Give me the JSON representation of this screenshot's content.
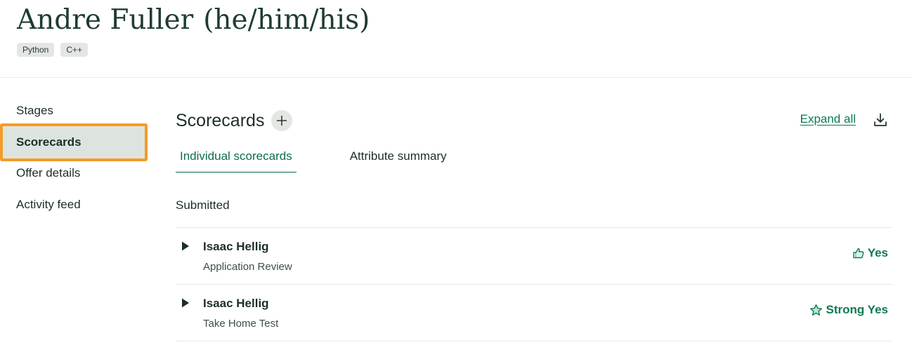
{
  "candidate": {
    "name": "Andre Fuller",
    "pronouns": "(he/him/his)",
    "tags": [
      "Python",
      "C++"
    ]
  },
  "sidebar": {
    "items": [
      {
        "label": "Stages"
      },
      {
        "label": "Scorecards",
        "active": true
      },
      {
        "label": "Offer details"
      },
      {
        "label": "Activity feed"
      }
    ]
  },
  "scorecards": {
    "title": "Scorecards",
    "add_icon": "plus-icon",
    "expand_all_label": "Expand all",
    "download_icon": "download-icon",
    "tabs": [
      {
        "label": "Individual scorecards",
        "active": true
      },
      {
        "label": "Attribute summary"
      }
    ],
    "section_label": "Submitted",
    "rows": [
      {
        "name": "Isaac Hellig",
        "stage": "Application Review",
        "rating": "Yes",
        "rating_icon": "thumbs-up-icon"
      },
      {
        "name": "Isaac Hellig",
        "stage": "Take Home Test",
        "rating": "Strong Yes",
        "rating_icon": "star-icon"
      }
    ]
  },
  "colors": {
    "accent_green": "#0b7a4f",
    "highlight_orange": "#f59b26",
    "active_nav_bg": "#dde4e0",
    "text_dark": "#1c2f27"
  }
}
